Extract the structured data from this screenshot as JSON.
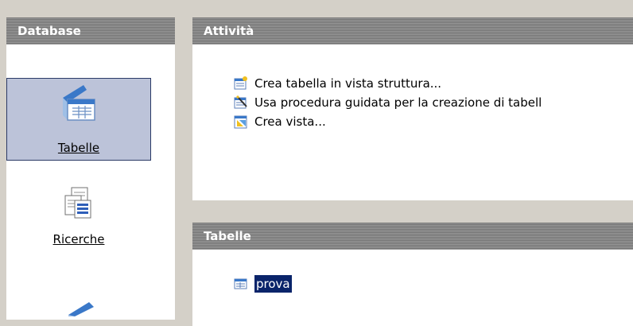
{
  "database_panel": {
    "title": "Database",
    "categories": [
      {
        "label": "Tabelle",
        "selected": true
      },
      {
        "label": "Ricerche",
        "selected": false
      }
    ]
  },
  "tasks_panel": {
    "title": "Attività",
    "tasks": [
      {
        "label": "Crea tabella in vista struttura...",
        "icon": "table-design-icon"
      },
      {
        "label": "Usa procedura guidata per la creazione di tabell",
        "icon": "table-wizard-icon"
      },
      {
        "label": "Crea vista...",
        "icon": "create-view-icon"
      }
    ]
  },
  "tables_panel": {
    "title": "Tabelle",
    "items": [
      {
        "label": "prova",
        "selected": true,
        "icon": "table-icon"
      }
    ]
  },
  "colors": {
    "header": "#727272",
    "selection": "#0a246a",
    "selected_category": "#bcc3d9",
    "background": "#d4d0c8"
  }
}
